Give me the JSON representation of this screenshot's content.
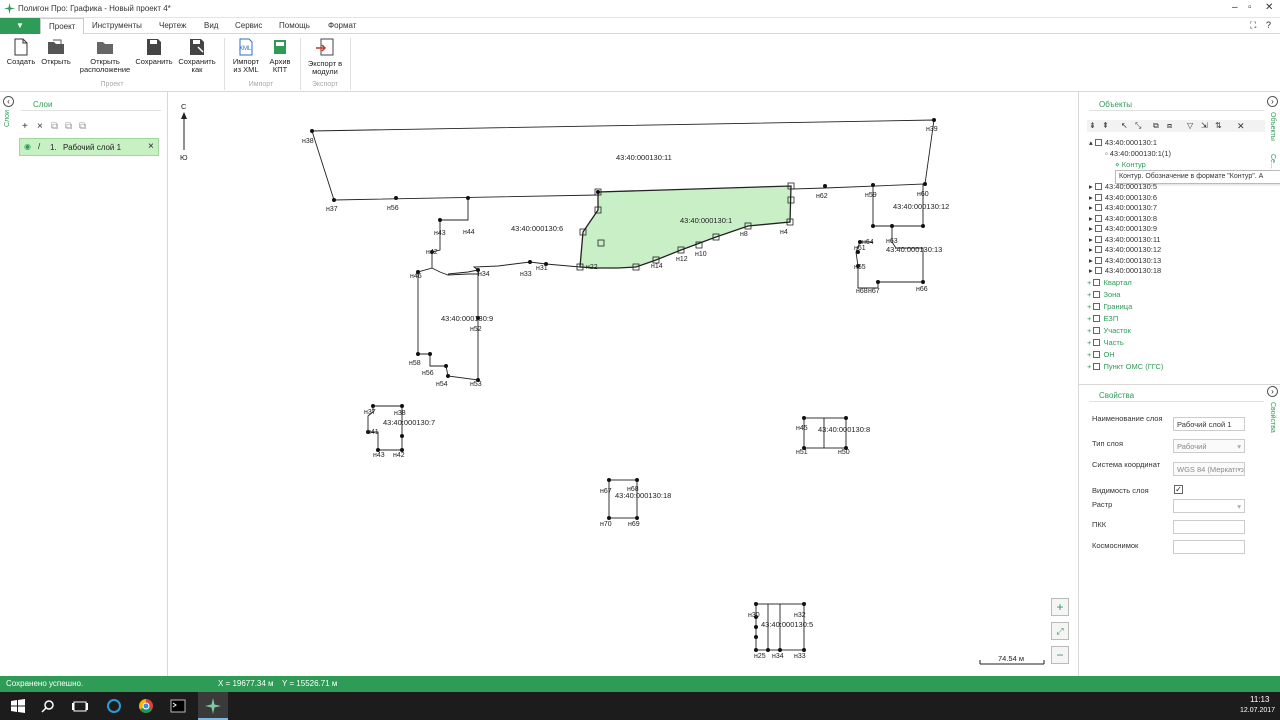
{
  "window": {
    "title": "Полигон Про: Графика - Новый проект 4*"
  },
  "menu": {
    "app_button": "▼",
    "items": [
      "Проект",
      "Инструменты",
      "Чертеж",
      "Вид",
      "Сервис",
      "Помощь",
      "Формат"
    ]
  },
  "ribbon": {
    "create": "Создать",
    "open": "Открыть",
    "open_location_1": "Открыть",
    "open_location_2": "расположение",
    "save": "Сохранить",
    "save_as_1": "Сохранить",
    "save_as_2": "как",
    "group_project": "Проект",
    "import_xml_1": "Импорт",
    "import_xml_2": "из XML",
    "xml_badge": "XML",
    "archive_kpt_1": "Архив",
    "archive_kpt_2": "КПТ",
    "group_import": "Импорт",
    "export_1": "Экспорт в",
    "export_2": "модули",
    "group_export": "Экспорт"
  },
  "left_panel": {
    "vertical_tab": "Слои",
    "title": "Слои",
    "layer": {
      "number": "1.",
      "name": "Рабочий слой 1"
    }
  },
  "compass": {
    "north": "С",
    "south": "Ю"
  },
  "scale_bar": "74.54 м",
  "parcels": {
    "p11": "43:40:000130:11",
    "p1": "43:40:000130:1",
    "p6": "43:40:000130:6",
    "p12": "43:40:000130:12",
    "p13": "43:40:000130:13",
    "p9": "43:40:000130:9",
    "p7": "43:40:000130:7",
    "p8": "43:40:000130:8",
    "p18": "43:40:000130:18",
    "p5": "43:40:000130:5"
  },
  "points": {
    "n38": "н38",
    "n39": "н39",
    "n37": "н37",
    "n56": "н56",
    "n62": "н62",
    "n60": "н60",
    "n59": "н59",
    "n63": "н63",
    "n4": "н4",
    "n8": "н8",
    "n10": "н10",
    "n12": "н12",
    "n14": "н14",
    "n31": "н31",
    "n33": "н33",
    "n34": "н34",
    "n44": "н44",
    "n43": "н43",
    "n42": "н42",
    "n46": "н46",
    "n52": "н52",
    "n53": "н53",
    "n54": "н54",
    "n58": "н58",
    "n56b": "н56",
    "n64": "н64",
    "n61": "н61",
    "n65": "н65",
    "n66": "н66",
    "n67": "н67",
    "n68": "н68",
    "n22": "н22",
    "n37b": "н37",
    "n38b": "н38",
    "n41": "н41",
    "n43b": "н43",
    "n42b": "н42",
    "n45": "н45",
    "n51": "н51",
    "n50": "н50",
    "n67b": "н67",
    "n68b": "н68",
    "n70": "н70",
    "n69": "н69",
    "n30": "н30",
    "n32": "н32",
    "n33b": "н33",
    "n34b": "н34",
    "n25": "н25"
  },
  "right_panel": {
    "objects_title": "Объекты",
    "vtab_objects": "Объекты",
    "vtab_2": "Се...",
    "tree": {
      "root": "43:40:000130:1",
      "child": "43:40:000130:1(1)",
      "contour": "Контур",
      "items": [
        "43:40:000130:5",
        "43:40:000130:6",
        "43:40:000130:7",
        "43:40:000130:8",
        "43:40:000130:9",
        "43:40:000130:11",
        "43:40:000130:12",
        "43:40:000130:13",
        "43:40:000130:18"
      ],
      "categories": [
        "Квартал",
        "Зона",
        "Граница",
        "ЕЗП",
        "Участок",
        "Часть",
        "ОН",
        "Пункт ОМС (ГГС)"
      ]
    },
    "tooltip": "Контур. Обозначение в формате \"Контур\". А",
    "props_title": "Свойства",
    "vtab_props": "Свойства",
    "props": {
      "name_label": "Наименование слоя",
      "name_value": "Рабочий слой 1",
      "type_label": "Тип слоя",
      "type_value": "Рабочий",
      "crs_label": "Система координат",
      "crs_value": "WGS 84 (Меркатор)",
      "visible_label": "Видимость слоя",
      "visible_value": "✓",
      "raster_label": "Растр",
      "pkk_label": "ПКК",
      "satellite_label": "Космоснимок"
    }
  },
  "status": {
    "message": "Сохранено успешно.",
    "x": "X = 19677.34 м",
    "y": "Y = 15526.71 м"
  },
  "taskbar": {
    "time": "11:13",
    "date": "12.07.2017"
  },
  "colors": {
    "accent": "#2e9b57",
    "parcel_fill": "#c8efc6"
  }
}
